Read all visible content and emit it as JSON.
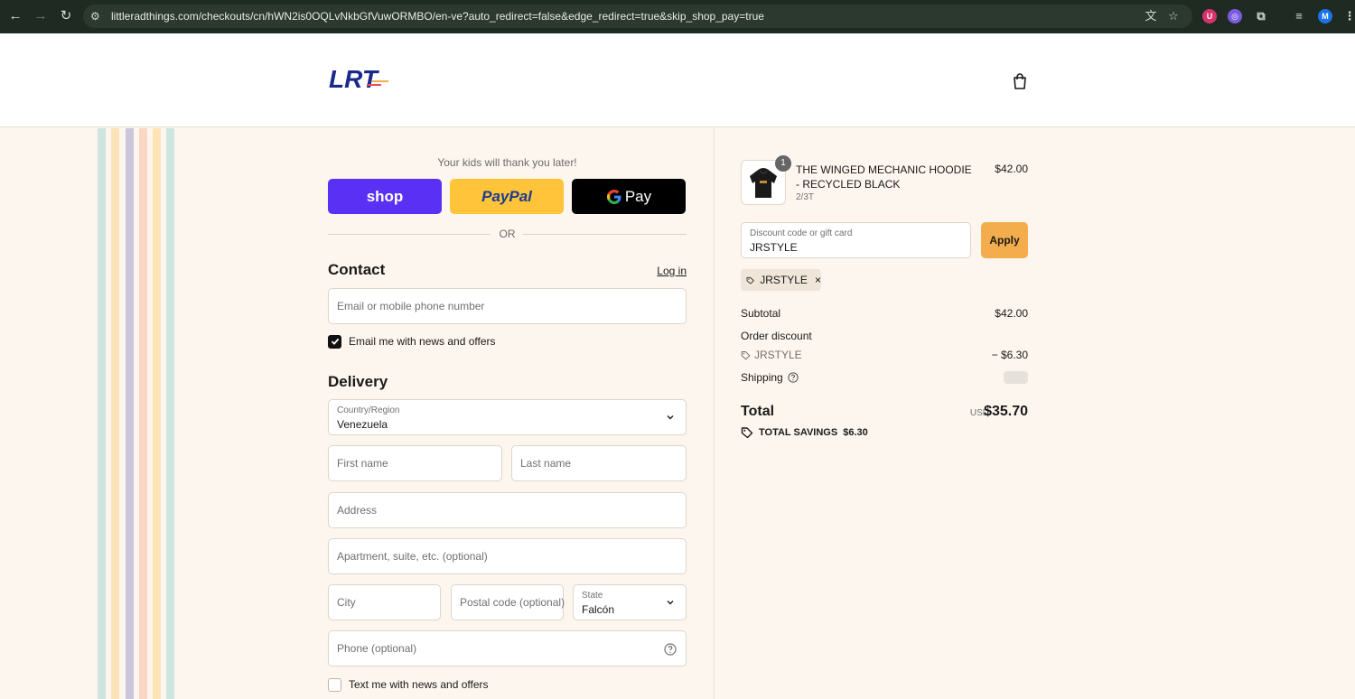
{
  "browser": {
    "url": "littleradthings.com/checkouts/cn/hWN2is0OQLvNkbGfVuwORMBO/en-ve?auto_redirect=false&edge_redirect=true&skip_shop_pay=true",
    "profile_initial": "M"
  },
  "header": {
    "logo_text": "LRT"
  },
  "express": {
    "tagline": "Your kids will thank you later!",
    "shop_label": "shop",
    "paypal_label": "PayPal",
    "gpay_label": "Pay",
    "or_label": "OR"
  },
  "contact": {
    "title": "Contact",
    "login_label": "Log in",
    "email_placeholder": "Email or mobile phone number",
    "newsletter_label": "Email me with news and offers",
    "newsletter_checked": true
  },
  "delivery": {
    "title": "Delivery",
    "country_label": "Country/Region",
    "country_value": "Venezuela",
    "first_name_placeholder": "First name",
    "last_name_placeholder": "Last name",
    "address_placeholder": "Address",
    "apartment_placeholder": "Apartment, suite, etc. (optional)",
    "city_placeholder": "City",
    "postal_placeholder": "Postal code (optional)",
    "state_label": "State",
    "state_value": "Falcón",
    "phone_placeholder": "Phone (optional)",
    "sms_label": "Text me with news and offers",
    "sms_checked": false
  },
  "order": {
    "item": {
      "quantity": "1",
      "name": "THE WINGED MECHANIC HOODIE - RECYCLED BLACK",
      "variant": "2/3T",
      "price": "$42.00"
    },
    "discount_label": "Discount code or gift card",
    "discount_value": "JRSTYLE",
    "apply_label": "Apply",
    "applied_code": "JRSTYLE",
    "subtotal_label": "Subtotal",
    "subtotal_value": "$42.00",
    "order_discount_label": "Order discount",
    "discount_code_line": "JRSTYLE",
    "discount_amount": "− $6.30",
    "shipping_label": "Shipping",
    "total_label": "Total",
    "currency": "USD",
    "total_value": "$35.70",
    "savings_label": "TOTAL SAVINGS",
    "savings_value": "$6.30"
  },
  "colors": {
    "accent": "#f4ad4d",
    "shop": "#5a31f4",
    "paypal": "#ffc439",
    "gpay": "#000000",
    "page_bg": "#fdf6ee"
  }
}
